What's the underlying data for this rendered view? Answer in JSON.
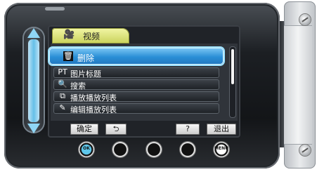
{
  "header": {
    "tab_label": "视频",
    "tab_icon": "video-camera-icon"
  },
  "menu": {
    "items": [
      {
        "label": "删除",
        "icon": "trash-icon",
        "icon_glyph": "🗑"
      },
      {
        "label": "图片标题",
        "icon": "picture-title-icon",
        "icon_glyph": "PT"
      },
      {
        "label": "搜索",
        "icon": "search-icon",
        "icon_glyph": "🔍"
      },
      {
        "label": "播放播放列表",
        "icon": "playlist-play-icon",
        "icon_glyph": "⧉"
      },
      {
        "label": "编辑播放列表",
        "icon": "playlist-edit-icon",
        "icon_glyph": "✎"
      }
    ],
    "selected_index": 0
  },
  "buttons": {
    "confirm": "确定",
    "back": "⮌",
    "help": "?",
    "exit": "退出"
  },
  "hardware": {
    "ok": "OK",
    "menu": "MENU"
  },
  "colors": {
    "selection": "#2a8fd6",
    "tab": "#d9e06a",
    "slider": "#65bfe8"
  }
}
